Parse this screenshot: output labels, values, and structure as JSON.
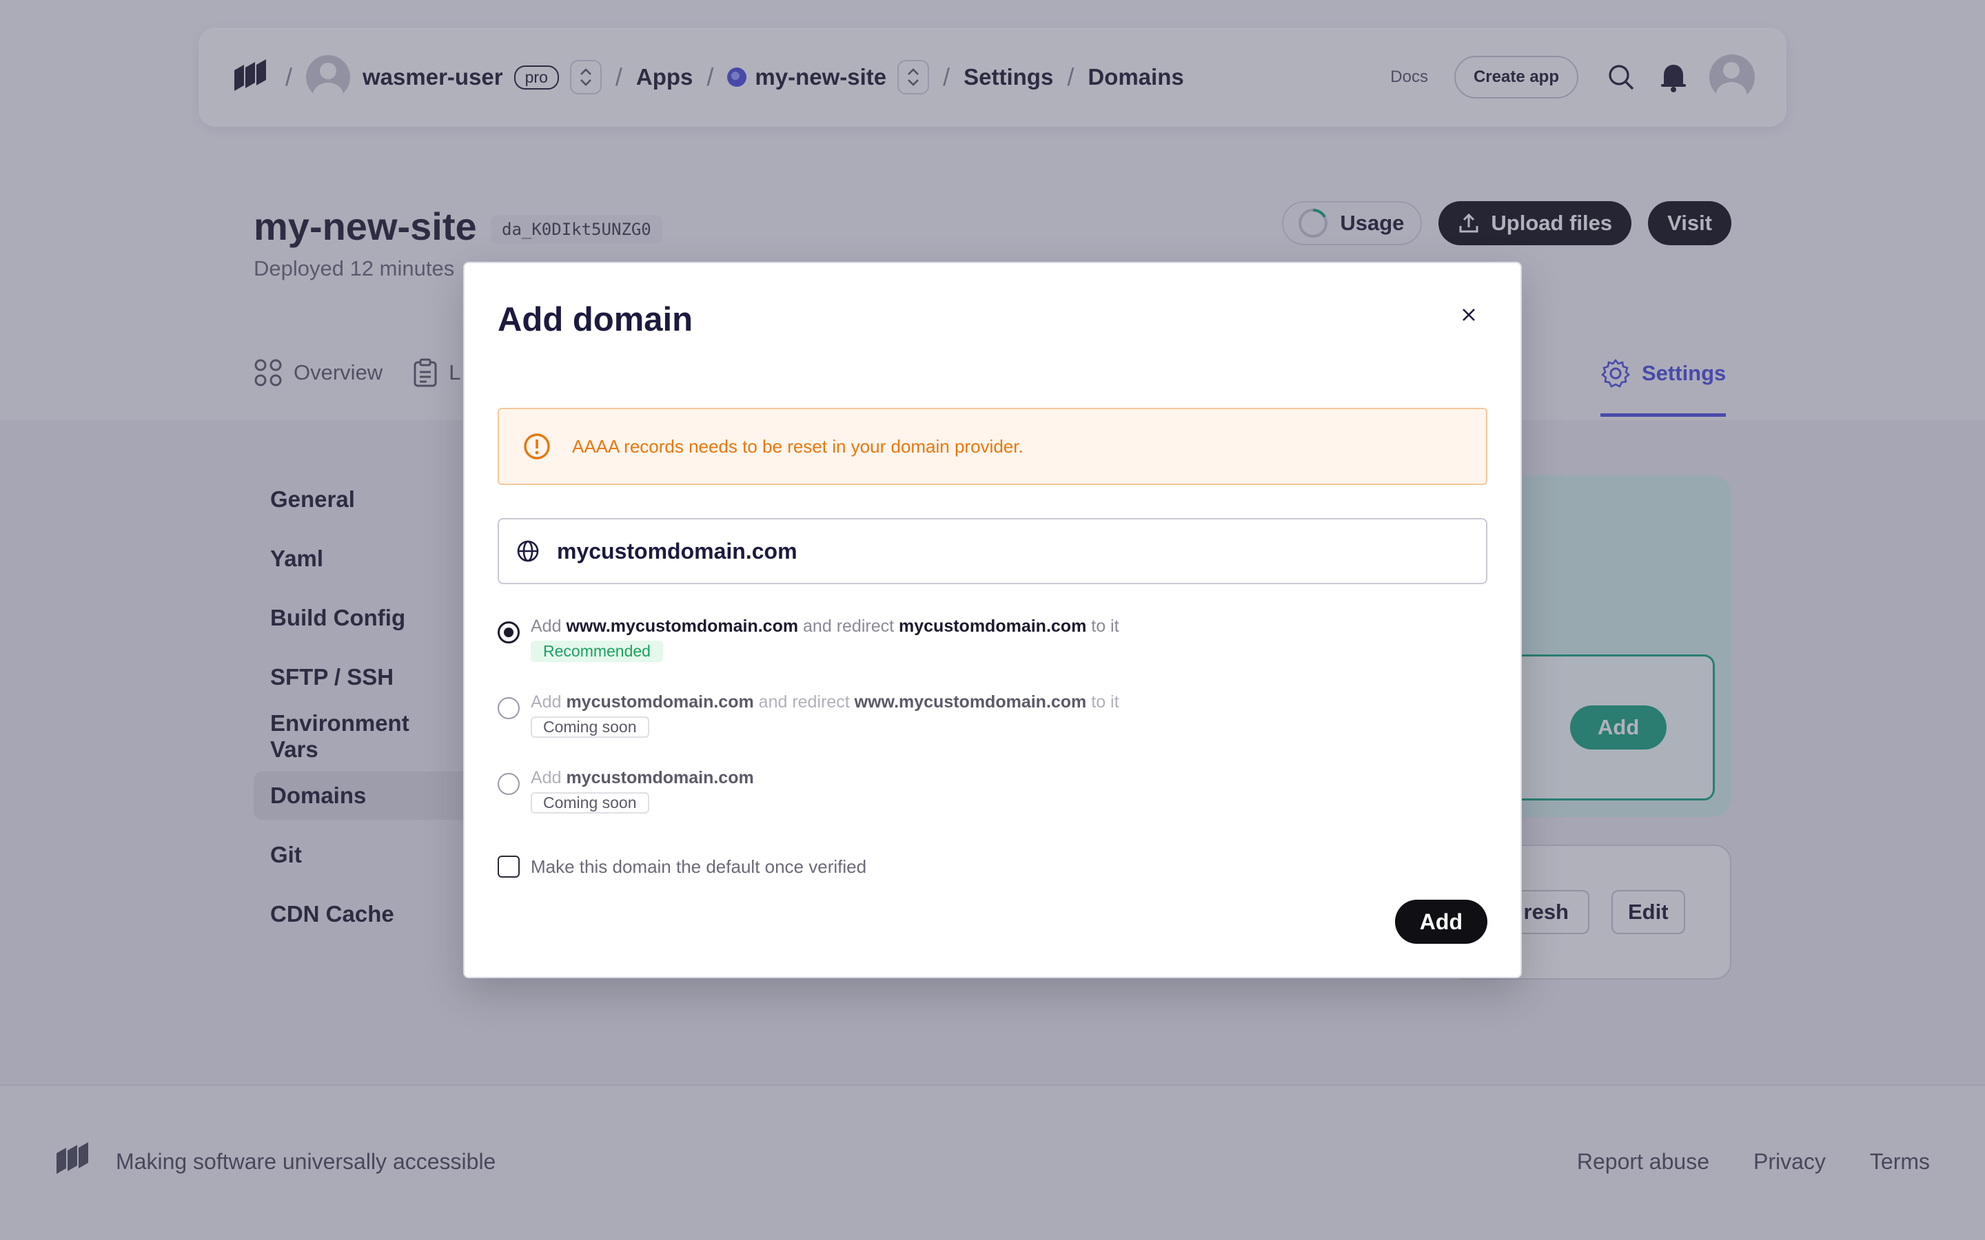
{
  "navbar": {
    "user": "wasmer-user",
    "plan_badge": "pro",
    "crumbs": {
      "apps": "Apps",
      "site": "my-new-site",
      "settings": "Settings",
      "domains": "Domains"
    },
    "separator": "/",
    "docs": "Docs",
    "create_app": "Create app",
    "icons": [
      "wasmer-logo-icon",
      "search-icon",
      "bell-icon"
    ]
  },
  "site": {
    "title": "my-new-site",
    "id": "da_K0DIkt5UNZG0",
    "deployed": "Deployed 12 minutes"
  },
  "actions": {
    "usage": "Usage",
    "upload": "Upload files",
    "visit": "Visit"
  },
  "tabs": {
    "overview": "Overview",
    "second_initial": "L",
    "settings": "Settings"
  },
  "sidebar": {
    "items": [
      {
        "label": "General"
      },
      {
        "label": "Yaml"
      },
      {
        "label": "Build Config"
      },
      {
        "label": "SFTP / SSH"
      },
      {
        "label": "Environment Vars"
      },
      {
        "label": "Domains",
        "active": true
      },
      {
        "label": "Git"
      },
      {
        "label": "CDN Cache"
      }
    ]
  },
  "background": {
    "add": "Add",
    "refresh": "resh",
    "edit": "Edit"
  },
  "footer": {
    "tagline": "Making software universally accessible",
    "links": [
      "Report abuse",
      "Privacy",
      "Terms"
    ]
  },
  "modal": {
    "title": "Add domain",
    "alert": "AAAA records needs to be reset in your domain provider.",
    "domain_value": "mycustomdomain.com",
    "options": [
      {
        "prefix": "Add",
        "domain_a": "www.mycustomdomain.com",
        "middle": "and redirect",
        "domain_b": "mycustomdomain.com",
        "suffix": "to it",
        "badge": "Recommended",
        "selected": true
      },
      {
        "prefix": "Add",
        "domain_a": "mycustomdomain.com",
        "middle": "and redirect",
        "domain_b": "www.mycustomdomain.com",
        "suffix": "to it",
        "badge": "Coming soon",
        "selected": false
      },
      {
        "prefix": "Add",
        "domain_a": "mycustomdomain.com",
        "badge": "Coming soon",
        "selected": false
      }
    ],
    "checkbox_label": "Make this domain the default once verified",
    "checkbox_checked": false,
    "submit": "Add"
  },
  "colors": {
    "accent": "#4a4ee0",
    "alert_text": "#e8770e",
    "alert_bg": "#fff5ec",
    "success": "#18a67d",
    "recommended": "#1ea060",
    "dark": "#0f0f14"
  }
}
